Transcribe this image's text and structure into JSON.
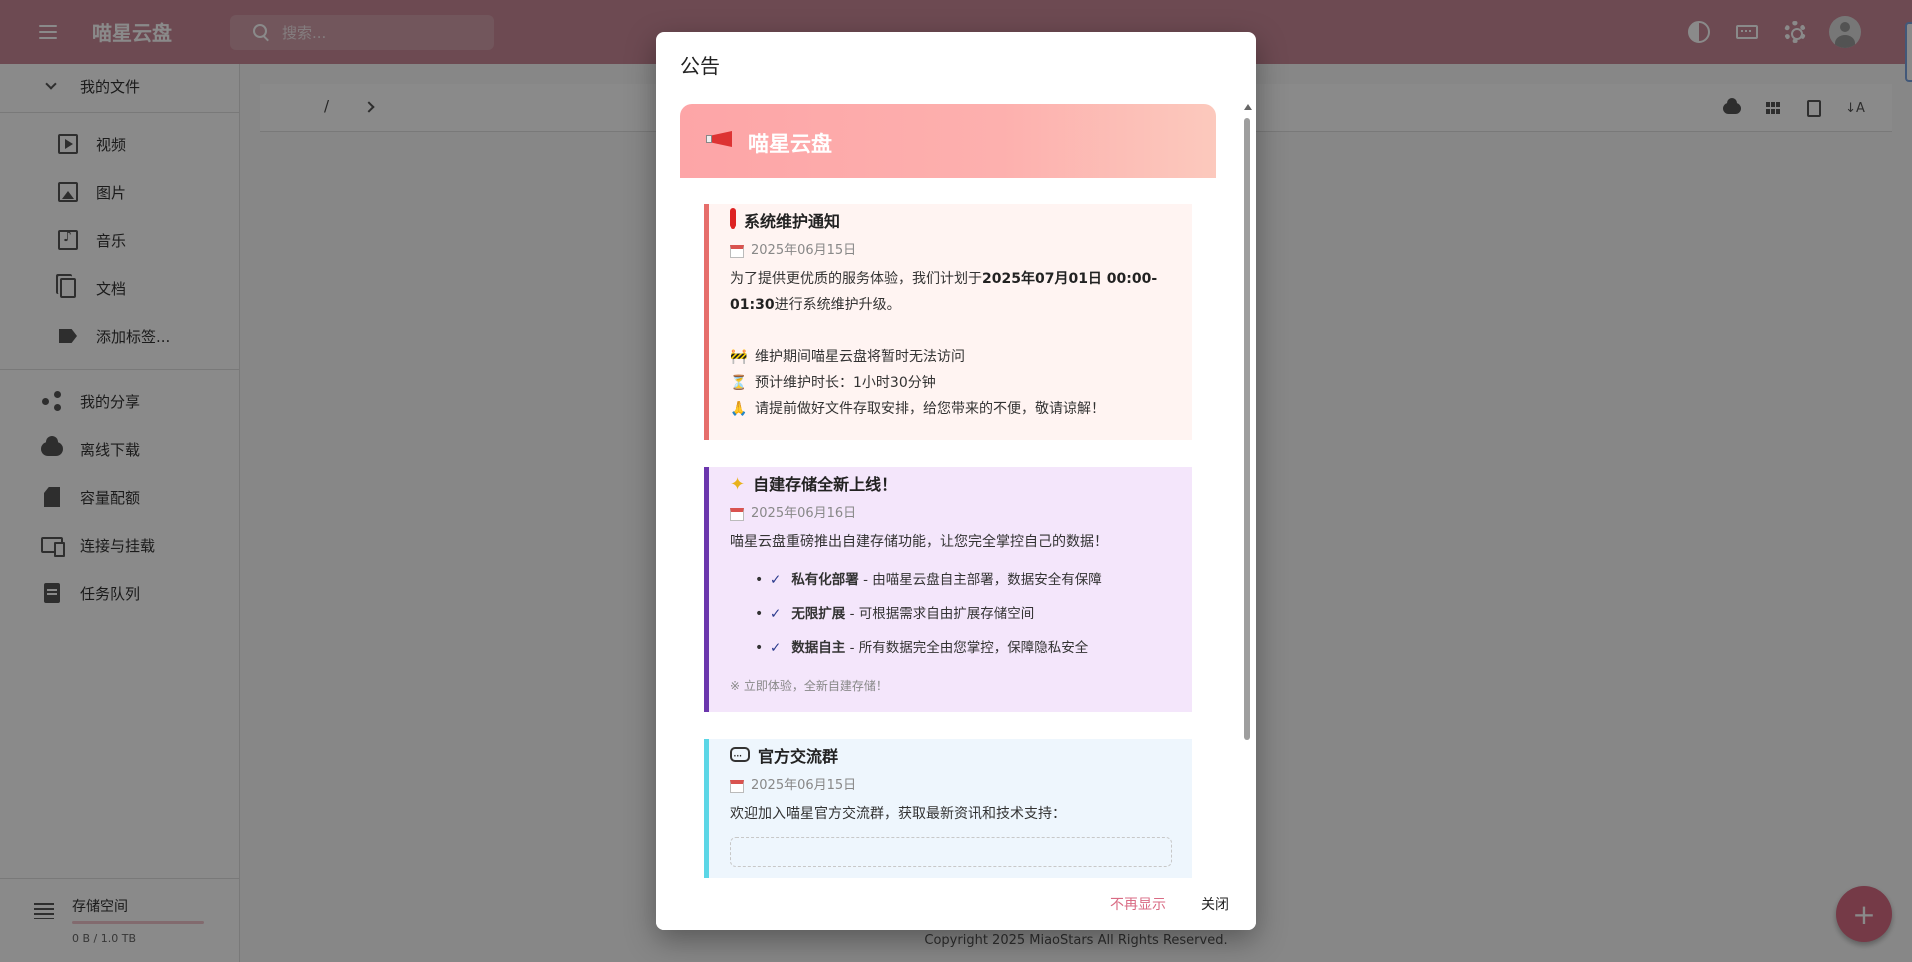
{
  "app": {
    "title": "喵星云盘",
    "search_placeholder": "搜索...",
    "accent": "#c98a98"
  },
  "sidebar": {
    "my_files": "我的文件",
    "file_items": [
      {
        "label": "视频",
        "icon": "video-icon"
      },
      {
        "label": "图片",
        "icon": "image-icon"
      },
      {
        "label": "音乐",
        "icon": "music-icon"
      },
      {
        "label": "文档",
        "icon": "document-icon"
      },
      {
        "label": "添加标签...",
        "icon": "add-tag-icon"
      }
    ],
    "items": [
      {
        "label": "我的分享",
        "icon": "share-icon"
      },
      {
        "label": "离线下载",
        "icon": "cloud-download-icon"
      },
      {
        "label": "容量配额",
        "icon": "sd-card-icon"
      },
      {
        "label": "连接与挂载",
        "icon": "devices-icon"
      },
      {
        "label": "任务队列",
        "icon": "clipboard-icon"
      }
    ],
    "storage": {
      "label": "存储空间",
      "usage": "0 B / 1.0 TB",
      "used_fraction": 0
    }
  },
  "main": {
    "breadcrumb_root": "/",
    "footer": "Copyright 2025 MiaoStars All Rights Reserved.",
    "sort_icon_text": "↓A"
  },
  "dialog": {
    "title": "公告",
    "header_title": "喵星云盘",
    "cards": {
      "maintenance": {
        "title": "系统维护通知",
        "date": "2025年06月15日",
        "text_pre": "为了提供更优质的服务体验，我们计划于",
        "text_bold": "2025年07月01日 00:00-01:30",
        "text_post": "进行系统维护升级。",
        "lines": [
          {
            "emoji": "🚧",
            "text": "维护期间喵星云盘将暂时无法访问"
          },
          {
            "emoji": "⏳",
            "text": "预计维护时长：1小时30分钟"
          },
          {
            "emoji": "🙏",
            "text": "请提前做好文件存取安排，给您带来的不便，敬请谅解！"
          }
        ]
      },
      "storage": {
        "title": "自建存储全新上线！",
        "date": "2025年06月16日",
        "intro": "喵星云盘重磅推出自建存储功能，让您完全掌控自己的数据！",
        "check": "✓",
        "features": [
          {
            "bold": "私有化部署",
            "text": " - 由喵星云盘自主部署，数据安全有保障"
          },
          {
            "bold": "无限扩展",
            "text": " - 可根据需求自由扩展存储空间"
          },
          {
            "bold": "数据自主",
            "text": " - 所有数据完全由您掌控，保障隐私安全"
          }
        ],
        "note": "※ 立即体验，全新自建存储！"
      },
      "group": {
        "title": "官方交流群",
        "date": "2025年06月15日",
        "text": "欢迎加入喵星官方交流群，获取最新资讯和技术支持："
      }
    },
    "actions": {
      "dont_show": "不再显示",
      "close": "关闭"
    }
  }
}
